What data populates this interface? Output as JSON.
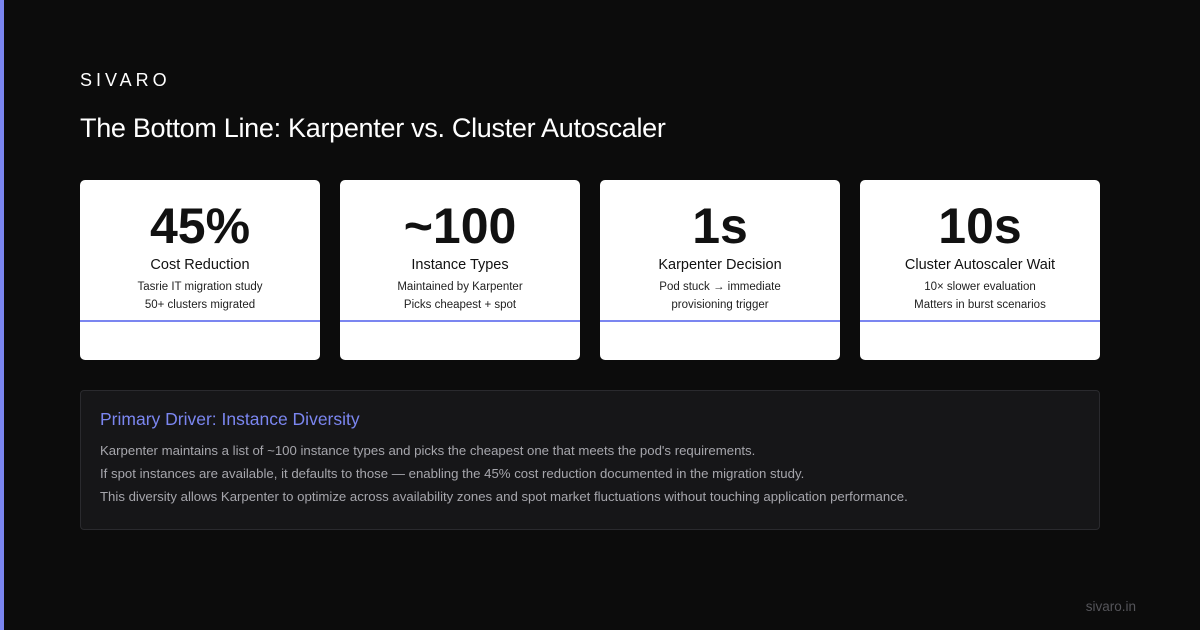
{
  "brand": "SIVARO",
  "title": "The Bottom Line: Karpenter vs. Cluster Autoscaler",
  "colors": {
    "background": "#0c0c0c",
    "accent": "#7b86f0",
    "card_background": "#ffffff",
    "panel_background": "#161618"
  },
  "cards": [
    {
      "value": "45%",
      "label": "Cost Reduction",
      "line1": "Tasrie IT migration study",
      "line2": "50+ clusters migrated"
    },
    {
      "value": "~100",
      "label": "Instance Types",
      "line1": "Maintained by Karpenter",
      "line2": "Picks cheapest + spot"
    },
    {
      "value": "1s",
      "label": "Karpenter Decision",
      "line1": "Pod stuck → immediate",
      "line2": "provisioning trigger"
    },
    {
      "value": "10s",
      "label": "Cluster Autoscaler Wait",
      "line1": "10× slower evaluation",
      "line2": "Matters in burst scenarios"
    }
  ],
  "driver": {
    "title": "Primary Driver: Instance Diversity",
    "lines": [
      "Karpenter maintains a list of ~100 instance types and picks the cheapest one that meets the pod's requirements.",
      "If spot instances are available, it defaults to those — enabling the 45% cost reduction documented in the migration study.",
      "This diversity allows Karpenter to optimize across availability zones and spot market fluctuations without touching application performance."
    ]
  },
  "footer": {
    "url": "sivaro.in"
  }
}
